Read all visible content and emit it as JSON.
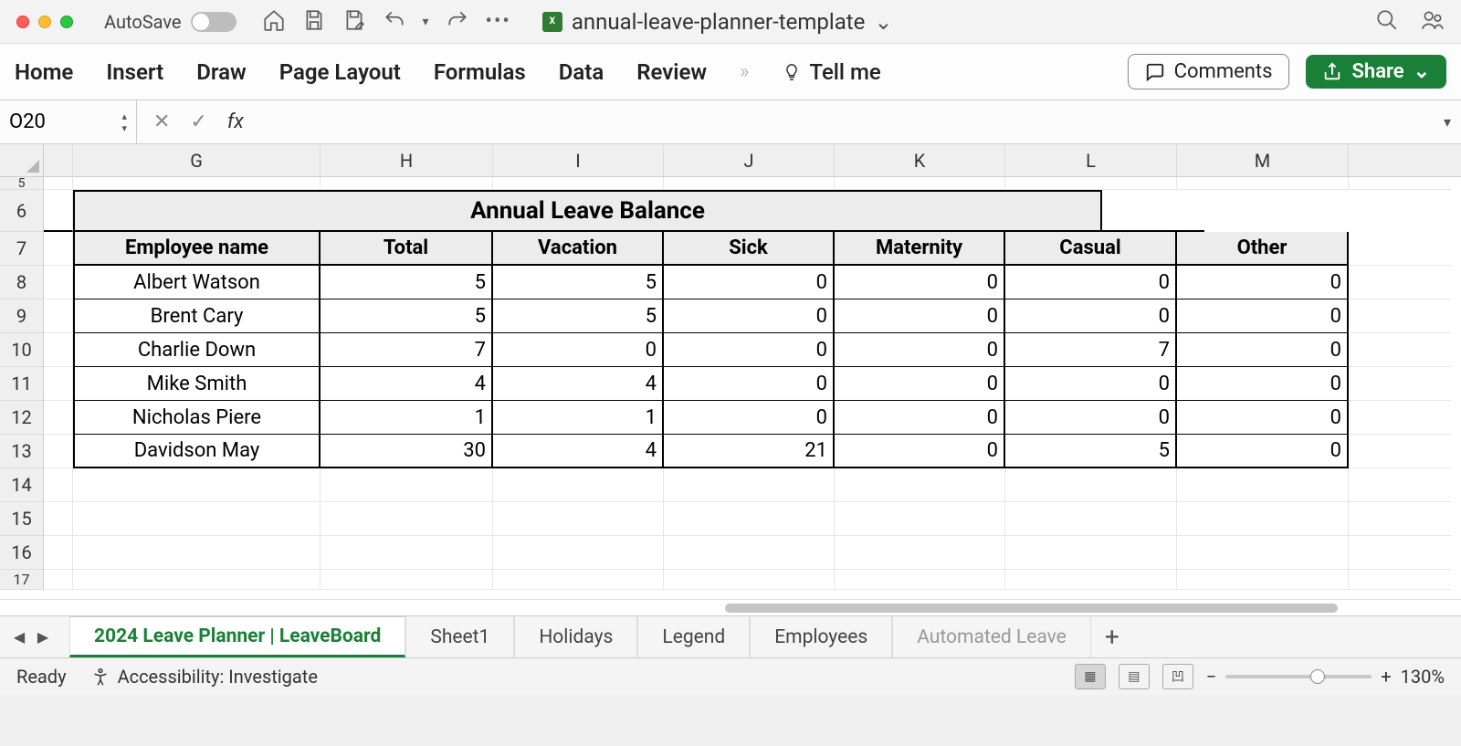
{
  "titlebar": {
    "autosave_label": "AutoSave",
    "doc_name": "annual-leave-planner-template"
  },
  "ribbon": {
    "tabs": [
      "Home",
      "Insert",
      "Draw",
      "Page Layout",
      "Formulas",
      "Data",
      "Review"
    ],
    "tell_me": "Tell me",
    "comments": "Comments",
    "share": "Share"
  },
  "formula_bar": {
    "name_box": "O20",
    "formula": ""
  },
  "columns": [
    "G",
    "H",
    "I",
    "J",
    "K",
    "L",
    "M"
  ],
  "row_numbers": [
    "5",
    "6",
    "7",
    "8",
    "9",
    "10",
    "11",
    "12",
    "13",
    "14",
    "15",
    "16",
    "17"
  ],
  "table": {
    "title": "Annual Leave Balance",
    "headers": [
      "Employee name",
      "Total",
      "Vacation",
      "Sick",
      "Maternity",
      "Casual",
      "Other"
    ],
    "rows": [
      {
        "name": "Albert Watson",
        "total": "5",
        "vacation": "5",
        "sick": "0",
        "maternity": "0",
        "casual": "0",
        "other": "0"
      },
      {
        "name": "Brent Cary",
        "total": "5",
        "vacation": "5",
        "sick": "0",
        "maternity": "0",
        "casual": "0",
        "other": "0"
      },
      {
        "name": "Charlie Down",
        "total": "7",
        "vacation": "0",
        "sick": "0",
        "maternity": "0",
        "casual": "7",
        "other": "0"
      },
      {
        "name": "Mike Smith",
        "total": "4",
        "vacation": "4",
        "sick": "0",
        "maternity": "0",
        "casual": "0",
        "other": "0"
      },
      {
        "name": "Nicholas Piere",
        "total": "1",
        "vacation": "1",
        "sick": "0",
        "maternity": "0",
        "casual": "0",
        "other": "0"
      },
      {
        "name": "Davidson May",
        "total": "30",
        "vacation": "4",
        "sick": "21",
        "maternity": "0",
        "casual": "5",
        "other": "0"
      }
    ]
  },
  "sheets": {
    "active": "2024 Leave Planner | LeaveBoard",
    "others": [
      "Sheet1",
      "Holidays",
      "Legend",
      "Employees",
      "Automated Leave"
    ]
  },
  "status": {
    "ready": "Ready",
    "accessibility": "Accessibility: Investigate",
    "zoom": "130%"
  }
}
